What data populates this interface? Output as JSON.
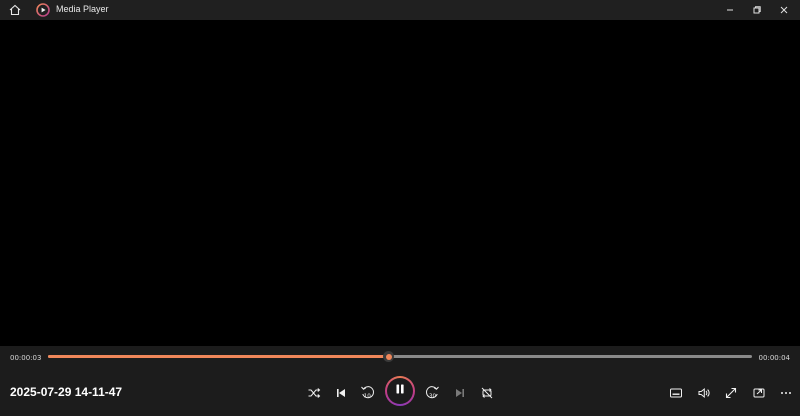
{
  "window": {
    "title": "Media Player",
    "accent": "#f0875a",
    "home_icon": "home-icon",
    "app_icon": "media-player-icon"
  },
  "window_controls": [
    "minimize-icon",
    "restore-icon",
    "close-icon"
  ],
  "player": {
    "elapsed": "00:00:03",
    "total": "00:00:04",
    "progress": 0.483,
    "media_title": "2025-07-29 14-11-47",
    "state": "playing"
  },
  "center_controls": [
    "shuffle-icon",
    "previous-icon",
    "skip-back-10-icon",
    "pause-icon",
    "skip-forward-30-icon",
    "next-icon",
    "repeat-icon"
  ],
  "right_controls": [
    "captions-icon",
    "volume-icon",
    "fullscreen-icon",
    "miniplayer-icon",
    "more-icon"
  ]
}
